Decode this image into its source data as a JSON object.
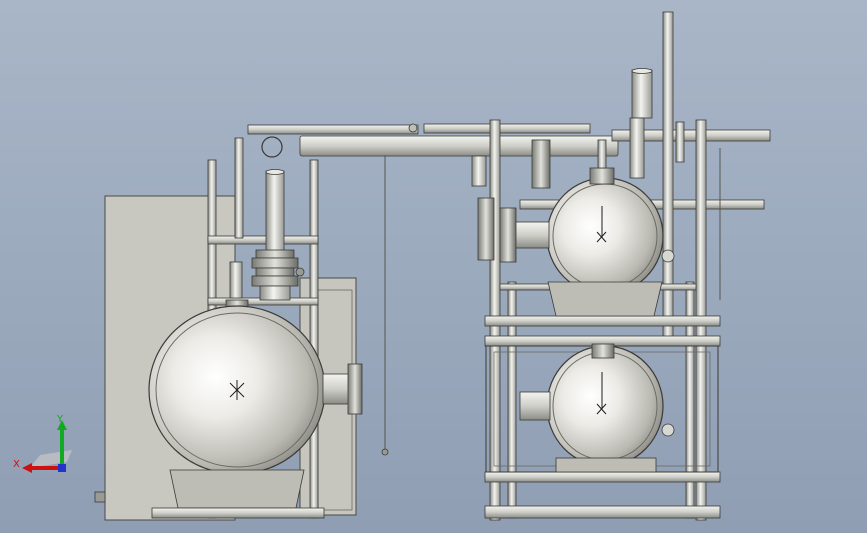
{
  "viewport": {
    "background_top": "#a9b6c8",
    "background_bottom": "#8f9eb3"
  },
  "model": {
    "metal_light": "#f4f4f2",
    "metal_mid": "#c9c9c4",
    "metal_dark": "#6f6f6a",
    "panel_fill": "#c8c8c0",
    "outline": "#3a3a38"
  },
  "triad": {
    "x_label": "X",
    "y_label": "Y",
    "x_color": "#cc1111",
    "y_color": "#11aa22",
    "z_color": "#2233cc"
  }
}
